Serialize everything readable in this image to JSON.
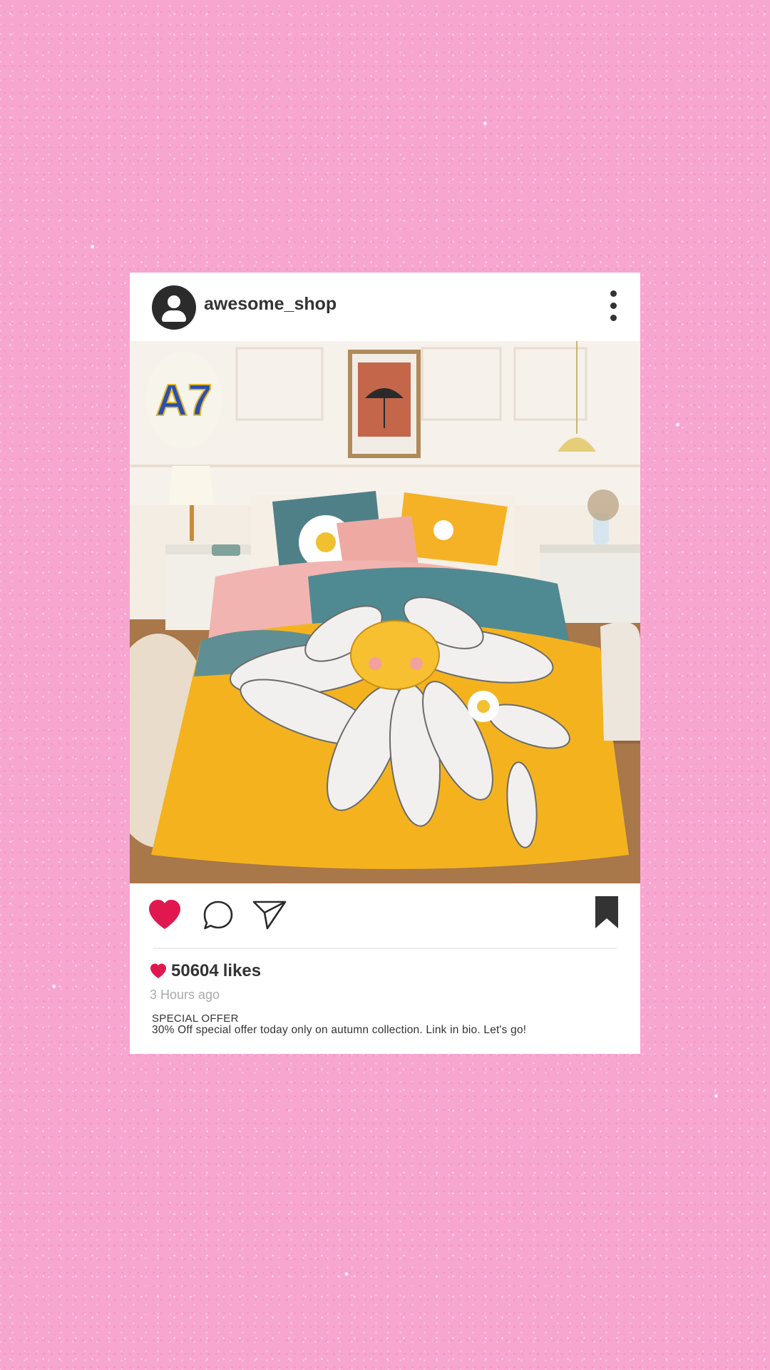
{
  "post": {
    "username": "awesome_shop",
    "photo_badge": "A7",
    "likes_count": "50604",
    "likes_word": "likes",
    "time_ago": "3 Hours ago",
    "caption_title": "SPECIAL OFFER",
    "caption_body": "30% Off special offer today only on autumn collection. Link in bio. Let's go!"
  },
  "icons": {
    "avatar": "user-icon",
    "more": "more-vertical-icon",
    "like": "heart-icon",
    "comment": "comment-icon",
    "share": "send-icon",
    "save": "bookmark-icon"
  },
  "colors": {
    "background": "#f7a6d0",
    "card": "#ffffff",
    "like_red": "#e0184f",
    "text_dark": "#333333",
    "text_muted": "#a9a9a9"
  }
}
